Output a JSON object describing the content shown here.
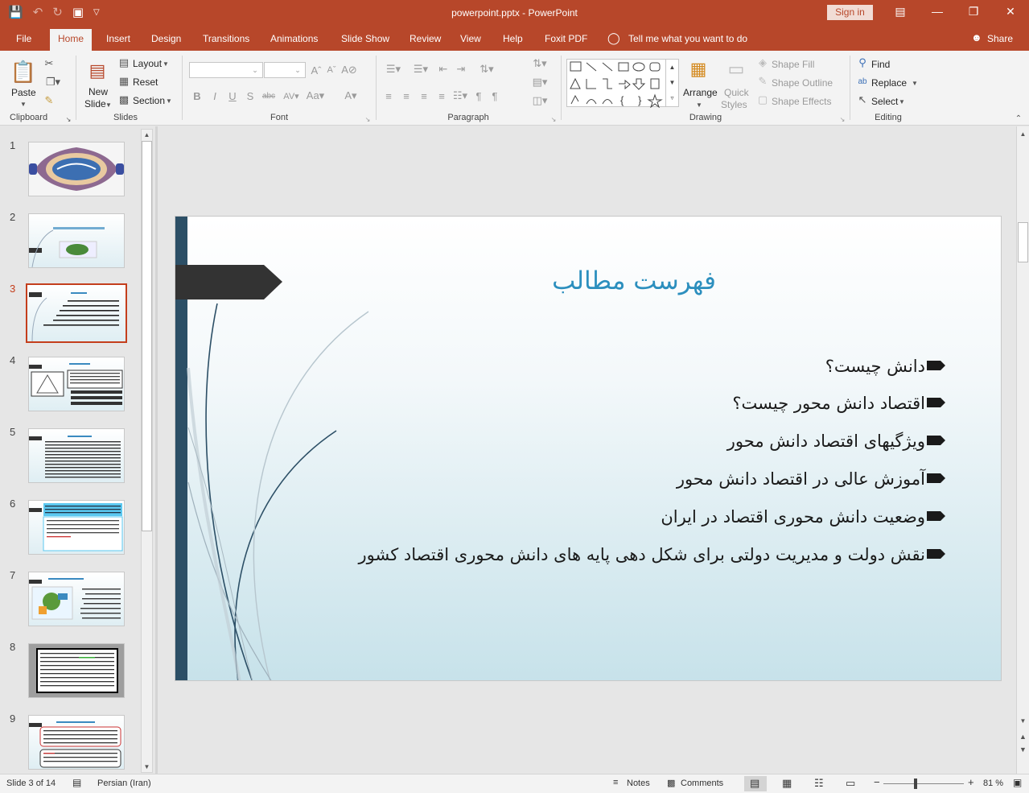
{
  "window": {
    "title": "powerpoint.pptx - PowerPoint",
    "sign_in": "Sign in"
  },
  "tabs": [
    "File",
    "Home",
    "Insert",
    "Design",
    "Transitions",
    "Animations",
    "Slide Show",
    "Review",
    "View",
    "Help",
    "Foxit PDF"
  ],
  "tell_me": "Tell me what you want to do",
  "share": "Share",
  "ribbon": {
    "clipboard": {
      "label": "Clipboard",
      "paste": "Paste"
    },
    "slides": {
      "label": "Slides",
      "new_slide_1": "New",
      "new_slide_2": "Slide",
      "layout": "Layout",
      "reset": "Reset",
      "section": "Section"
    },
    "font": {
      "label": "Font"
    },
    "paragraph": {
      "label": "Paragraph"
    },
    "drawing": {
      "label": "Drawing",
      "arrange": "Arrange",
      "quick_styles_1": "Quick",
      "quick_styles_2": "Styles",
      "shape_fill": "Shape Fill",
      "shape_outline": "Shape Outline",
      "shape_effects": "Shape Effects"
    },
    "editing": {
      "label": "Editing",
      "find": "Find",
      "replace": "Replace",
      "select": "Select"
    }
  },
  "thumbnails": [
    "1",
    "2",
    "3",
    "4",
    "5",
    "6",
    "7",
    "8",
    "9"
  ],
  "selected_slide": 3,
  "slide": {
    "title": "فهرست مطالب",
    "bullets": [
      "دانش چیست؟",
      "اقتصاد دانش محور چیست؟",
      "ویژگیهای اقتصاد دانش محور",
      "آموزش عالی در اقتصاد دانش محور",
      "وضعیت دانش محوری اقتصاد در ایران",
      "نقش دولت و مدیریت دولتی برای شکل دهی پایه های دانش محوری اقتصاد کشور"
    ]
  },
  "status": {
    "slide_of": "Slide 3 of 14",
    "language": "Persian (Iran)",
    "notes": "Notes",
    "comments": "Comments",
    "zoom": "81 %"
  },
  "colors": {
    "accent": "#b7472a",
    "title": "#2c8fbe",
    "selected": "#c43e1c"
  }
}
